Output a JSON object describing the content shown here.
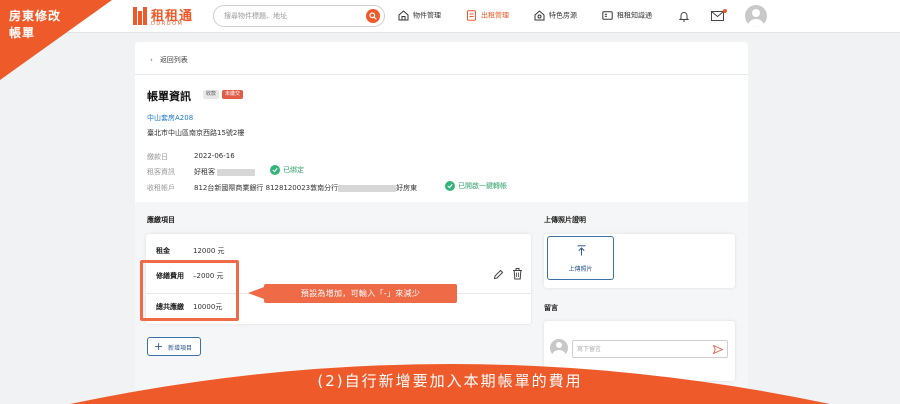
{
  "ribbon": {
    "line1": "房東修改",
    "line2": "帳單"
  },
  "logo": {
    "name": "租租通",
    "sub": "DDROOM"
  },
  "search": {
    "placeholder": "搜尋物件標題、地址"
  },
  "nav": {
    "items": [
      {
        "label": "物件管理",
        "icon": "house-icon",
        "active": false
      },
      {
        "label": "出租管理",
        "icon": "document-icon",
        "active": true
      },
      {
        "label": "特色房源",
        "icon": "home-star-icon",
        "active": false
      },
      {
        "label": "租租知識通",
        "icon": "book-icon",
        "active": false
      }
    ]
  },
  "back_label": "返回列表",
  "bill": {
    "title": "帳單資訊",
    "status_badge": "收款",
    "state_badge": "未繳交",
    "property_name": "中山套房A208",
    "address": "臺北市中山區南京西路15號2樓",
    "info": [
      {
        "label": "繳款日",
        "value": "2022-06-16"
      },
      {
        "label": "租客資訊",
        "value": "好租客",
        "verified": "已綁定"
      },
      {
        "label": "收租帳戶",
        "value_prefix": "812台新國際商業銀行 8128120023敦南分行",
        "value_suffix": "好房東",
        "verified": "已開啟一鍵轉帳"
      }
    ]
  },
  "sections": {
    "items": "應繳項目",
    "upload": "上傳照片證明",
    "message": "留言"
  },
  "line_items": [
    {
      "label": "租金",
      "value": "12000 元"
    },
    {
      "label": "修繕費用",
      "value": "–2000 元"
    },
    {
      "label": "總共應繳",
      "value": "10000元"
    }
  ],
  "add_item_label": "新增項目",
  "upload_label": "上傳照片",
  "message_placeholder": "寫下留言",
  "callout": "預設為增加，可輸入「-」來減少",
  "banner": "(2)自行新增要加入本期帳單的費用",
  "colors": {
    "brand": "#ef5a2a",
    "callout": "#ef6a47",
    "link": "#1a78c9",
    "success": "#2fa26a",
    "button": "#2c5a90"
  }
}
